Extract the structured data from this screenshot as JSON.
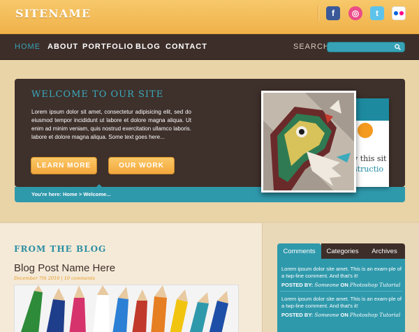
{
  "header": {
    "sitename": "SITENAME",
    "social": [
      {
        "name": "facebook-icon",
        "glyph": "f"
      },
      {
        "name": "dribbble-icon",
        "glyph": "◎"
      },
      {
        "name": "twitter-icon",
        "glyph": "t"
      },
      {
        "name": "flickr-icon",
        "glyph": ""
      }
    ]
  },
  "nav": {
    "items": [
      "HOME",
      "ABOUT",
      "PORTFOLIO",
      "BLOG",
      "CONTACT"
    ],
    "search_label": "SEARCH",
    "search_placeholder": ""
  },
  "hero": {
    "title": "WELCOME TO OUR SITE",
    "text": "Lorem ipsum dolor sit amet, consectetur adipisicing elit, sed do eiusmod tempor incididunt ut labore et dolore magna aliqua. Ut enim ad minim veniam, quis nostrud exercitation ullamco laboris. labore et dolore magna aliqua. Some text goes here...",
    "btn_learn": "LEARN MORE",
    "btn_work": "OUR WORK",
    "breadcrumb": "You're here: Home > Welcome...",
    "slide_text_1": "y this sit",
    "slide_text_2": "structio"
  },
  "blog": {
    "section_title": "FROM THE BLOG",
    "post_title": "Blog Post Name Here",
    "post_meta": "December 7th 2010 | 10 comments"
  },
  "sidebar": {
    "tabs": [
      "Comments",
      "Categories",
      "Archives"
    ],
    "comments": [
      {
        "text": "Lorem ipsum dolor site amet. This is an exam-ple of a twp-line comment. And that's it!",
        "by_label": "POSTED BY:",
        "author": "Someone",
        "on_label": "ON",
        "post": "Photoshop Tutorial"
      },
      {
        "text": "Lorem ipsum dolor site amet. This is an exam-ple of a twp-line comment. And that's it!",
        "by_label": "POSTED BY:",
        "author": "Someone",
        "on_label": "ON",
        "post": "Photoshop Tutorial"
      }
    ]
  },
  "colors": {
    "accent": "#2f99ac",
    "dark": "#3d2e29",
    "orange": "#f2a83c"
  }
}
